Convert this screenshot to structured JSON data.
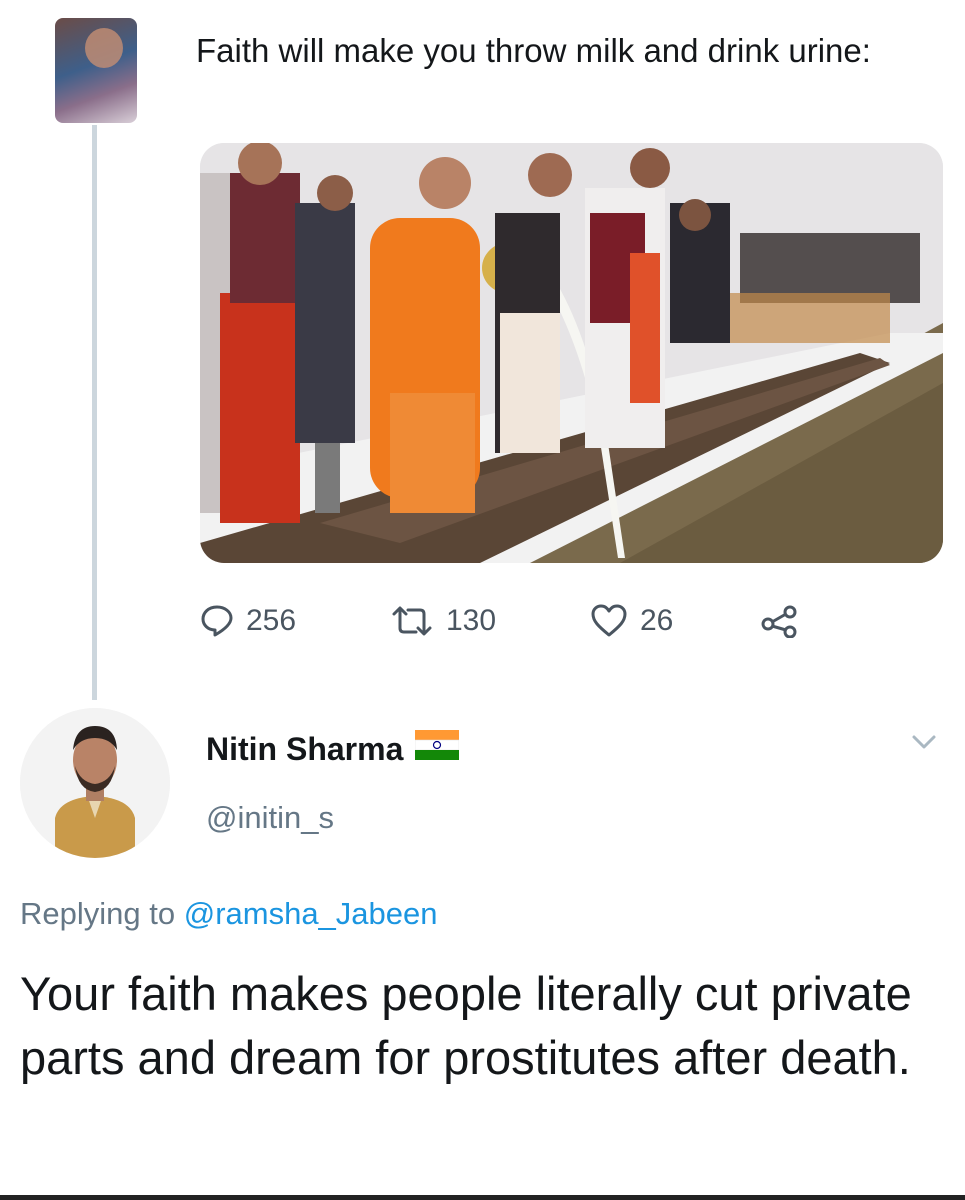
{
  "original_tweet": {
    "text": "Faith will make you throw milk and drink urine:",
    "avatar_icon": "user-avatar-icon",
    "media_description": "photo",
    "stats": {
      "replies": "256",
      "retweets": "130",
      "likes": "26"
    },
    "icons": [
      "reply-icon",
      "retweet-icon",
      "like-icon",
      "share-icon"
    ]
  },
  "reply_tweet": {
    "author_name": "Nitin Sharma",
    "author_handle": "@initin_s",
    "flag_icon": "india-flag-icon",
    "replying_prefix": "Replying to",
    "replying_to": "@ramsha_Jabeen",
    "text": "Your faith makes people literally cut private parts and dream for prostitutes after death."
  },
  "colors": {
    "link": "#1b95e0",
    "secondary_text": "#657786",
    "primary_text": "#14171a",
    "thread_line": "#ccd6dd"
  }
}
